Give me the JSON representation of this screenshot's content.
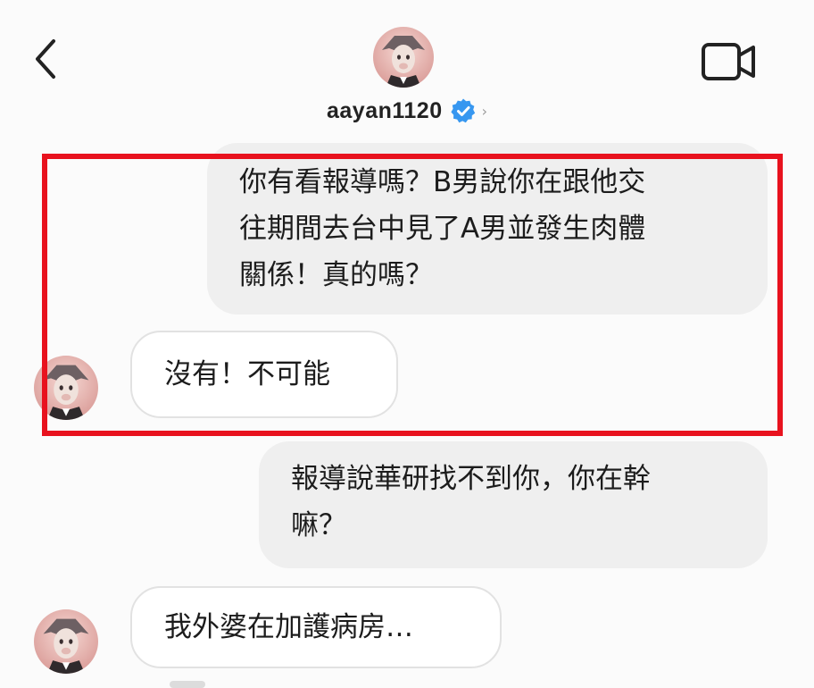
{
  "header": {
    "username": "aayan1120",
    "verified": true,
    "back_icon": "chevron-left-icon",
    "video_icon": "video-camera-icon",
    "avatar_icon": "profile-avatar-icon"
  },
  "messages": [
    {
      "side": "sent",
      "text_lines": [
        "你有看報導嗎？B男說你在跟他交",
        "往期間去台中見了A男並發生肉體",
        "關係！真的嗎？"
      ]
    },
    {
      "side": "received",
      "text": "沒有！不可能"
    },
    {
      "side": "sent",
      "text_lines": [
        "報導說華研找不到你，你在幹",
        "嘛？"
      ]
    },
    {
      "side": "received",
      "text": "我外婆在加護病房…"
    }
  ],
  "colors": {
    "highlight": "#e8121e",
    "verified_badge": "#3797f0",
    "sent_bubble": "#efefef",
    "received_bubble": "#ffffff"
  }
}
